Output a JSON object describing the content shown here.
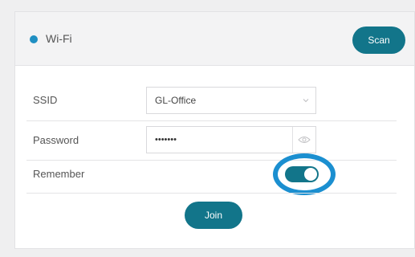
{
  "header": {
    "title": "Wi-Fi",
    "scan_label": "Scan"
  },
  "form": {
    "ssid_label": "SSID",
    "ssid_value": "GL-Office",
    "password_label": "Password",
    "password_value": "•••••••",
    "remember_label": "Remember",
    "remember_enabled": true,
    "join_label": "Join"
  },
  "colors": {
    "accent": "#12758a",
    "status_dot": "#1f8fc2",
    "highlight_ring": "#1b8fd0"
  },
  "icons": {
    "status": "status-dot",
    "dropdown": "chevron-down-icon",
    "password_toggle": "eye-icon"
  }
}
